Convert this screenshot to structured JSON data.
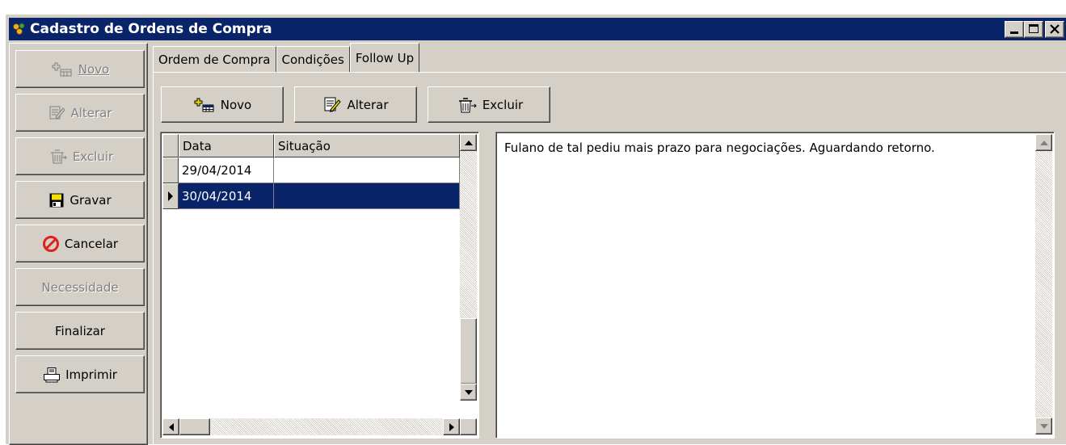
{
  "window": {
    "title": "Cadastro de Ordens de Compra"
  },
  "sidebar": {
    "buttons": [
      {
        "label": "Novo",
        "icon": "new-record-icon",
        "enabled": false
      },
      {
        "label": "Alterar",
        "icon": "edit-record-icon",
        "enabled": false
      },
      {
        "label": "Excluir",
        "icon": "delete-record-icon",
        "enabled": false
      },
      {
        "label": "Gravar",
        "icon": "save-floppy-icon",
        "enabled": true
      },
      {
        "label": "Cancelar",
        "icon": "cancel-circle-icon",
        "enabled": true
      },
      {
        "label": "Necessidade",
        "icon": "",
        "enabled": false
      },
      {
        "label": "Finalizar",
        "icon": "",
        "enabled": true
      },
      {
        "label": "Imprimir",
        "icon": "printer-icon",
        "enabled": true
      }
    ]
  },
  "tabs": [
    {
      "label": "Ordem de Compra",
      "active": false
    },
    {
      "label": "Condições",
      "active": false
    },
    {
      "label": "Follow Up",
      "active": true
    }
  ],
  "toolbar": {
    "new_label": "Novo",
    "edit_label": "Alterar",
    "delete_label": "Excluir"
  },
  "grid": {
    "columns": [
      "Data",
      "Situação"
    ],
    "rows": [
      {
        "data": "29/04/2014",
        "situacao": "",
        "selected": false
      },
      {
        "data": "30/04/2014",
        "situacao": "",
        "selected": true
      }
    ]
  },
  "memo": {
    "text": "Fulano de tal pediu mais prazo para negociações. Aguardando retorno."
  },
  "colors": {
    "titlebar": "#0a246a",
    "face": "#d4d0c8",
    "selection": "#0a246a",
    "cancel_red": "#e0201c"
  }
}
